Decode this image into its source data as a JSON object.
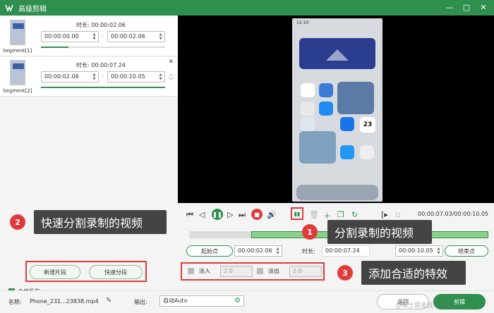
{
  "window": {
    "title": "高级剪辑",
    "controls": [
      "—",
      "□",
      "✕"
    ]
  },
  "segments": [
    {
      "label": "Segment[1]",
      "duration": "时长: 00:00:02.06",
      "start": "00:00:00.00",
      "end": "00:00:02.06",
      "progress": 0.22
    },
    {
      "label": "Segment[2]",
      "duration": "时长: 00:00:07.24",
      "start": "00:00:02.06",
      "end": "00:00:10.05",
      "progress": 1.0
    }
  ],
  "segment_dash": "-",
  "left_buttons": {
    "new_segment": "新增片段",
    "quick_split": "快速分段"
  },
  "merge_all": {
    "label": "合并所有",
    "checked": true
  },
  "preview": {
    "time": "12:10",
    "calendar_day": "23"
  },
  "playback": {
    "timecode": "00:00:07.03/00:00:10.05"
  },
  "points": {
    "start_label": "起始点",
    "start_value": "00:00:02.06",
    "duration_label": "时长:",
    "duration_value": "00:00:07.24",
    "end_value": "00:00:10.05",
    "end_label": "结束点"
  },
  "effects": {
    "fade_in_label": "淡入",
    "fade_in_value": "2.0",
    "fade_out_label": "淡出",
    "fade_out_value": "2.0"
  },
  "footer": {
    "name_label": "名称:",
    "filename": "Phone_231...23838.mp4",
    "output_label": "输出:",
    "output_value": "自动Auto",
    "back_label": "返回",
    "edit_label": "剪辑",
    "watermark": "@稀土掘金技术社区"
  },
  "callouts": {
    "c1": {
      "number": "1",
      "text": "分割录制的视频"
    },
    "c2": {
      "number": "2",
      "text": "快速分割录制的视频"
    },
    "c3": {
      "number": "3",
      "text": "添加合适的特效"
    }
  },
  "colors": {
    "accent": "#2f8f4e",
    "highlight": "#e03b3b",
    "callout_bg": "#444444"
  }
}
